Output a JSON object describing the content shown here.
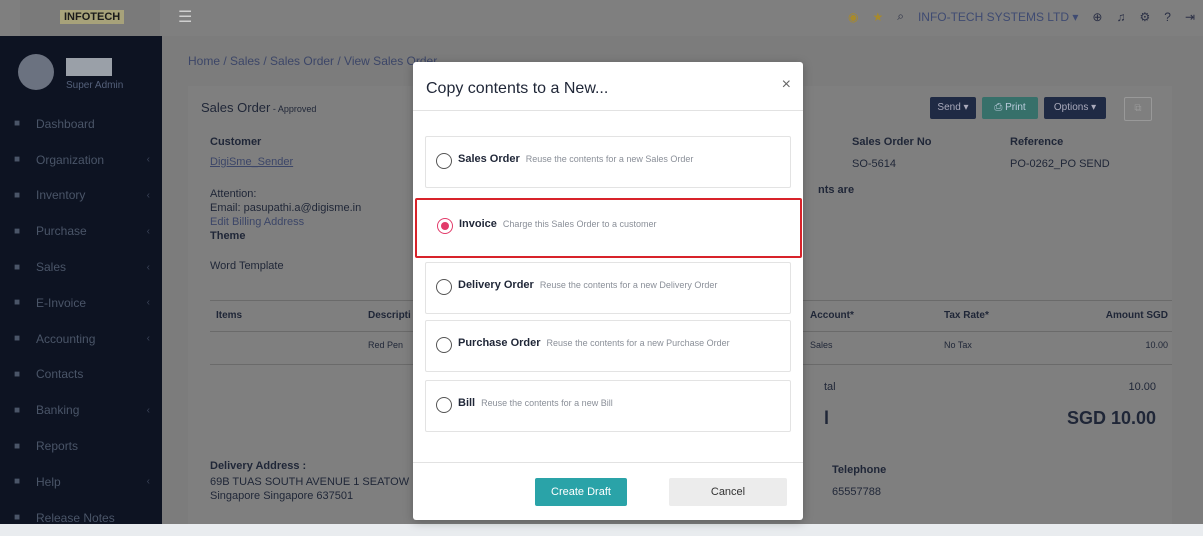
{
  "header": {
    "logo_text": "INFOTECH",
    "company": "INFO-TECH SYSTEMS LTD ▾"
  },
  "user": {
    "role": "Super Admin"
  },
  "sidebar": {
    "items": [
      {
        "label": "Dashboard",
        "icon": "dashboard-icon",
        "chev": false
      },
      {
        "label": "Organization",
        "icon": "organization-icon",
        "chev": true
      },
      {
        "label": "Inventory",
        "icon": "inventory-icon",
        "chev": true
      },
      {
        "label": "Purchase",
        "icon": "purchase-icon",
        "chev": true
      },
      {
        "label": "Sales",
        "icon": "sales-icon",
        "chev": true
      },
      {
        "label": "E-Invoice",
        "icon": "einvoice-icon",
        "chev": true
      },
      {
        "label": "Accounting",
        "icon": "accounting-icon",
        "chev": true
      },
      {
        "label": "Contacts",
        "icon": "contacts-icon",
        "chev": false
      },
      {
        "label": "Banking",
        "icon": "banking-icon",
        "chev": true
      },
      {
        "label": "Reports",
        "icon": "reports-icon",
        "chev": false
      },
      {
        "label": "Help",
        "icon": "help-icon",
        "chev": true
      },
      {
        "label": "Release Notes",
        "icon": "release-notes-icon",
        "chev": false
      }
    ]
  },
  "breadcrumb": "Home / Sales / Sales Order / View Sales Order",
  "order": {
    "title": "Sales Order",
    "status": " - Approved",
    "send_label": "Send ▾",
    "print_label": "⎙ Print",
    "options_label": "Options ▾",
    "customer_label": "Customer",
    "customer_name": "DigiSme_Sender",
    "attention_label": "Attention:",
    "email": "Email: pasupathi.a@digisme.in",
    "edit_billing": "Edit Billing Address",
    "theme_label": "Theme",
    "theme_value": "Word Template",
    "so_no_label": "Sales Order No",
    "so_no": "SO-5614",
    "reference_label": "Reference",
    "reference": "PO-0262_PO SEND",
    "amounts_are": "nts are",
    "table": {
      "headers": {
        "items": "Items",
        "desc": "Descripti",
        "account": "Account*",
        "tax": "Tax Rate*",
        "amount": "Amount SGD"
      },
      "row": {
        "desc": "Red Pen",
        "account": "Sales",
        "tax": "No Tax",
        "amount": "10.00"
      }
    },
    "subtotal_label": "tal",
    "subtotal": "10.00",
    "total_label": "l",
    "total": "SGD 10.00",
    "delivery_label": "Delivery Address :",
    "delivery_line1": "69B TUAS SOUTH AVENUE 1 SEATOW",
    "delivery_line2": "Singapore Singapore 637501",
    "telephone_label": "Telephone",
    "telephone": "65557788"
  },
  "modal": {
    "title": "Copy contents to a New...",
    "close": "×",
    "options": [
      {
        "name": "Sales Order",
        "desc": "Reuse the contents for a new Sales Order",
        "selected": false
      },
      {
        "name": "Invoice",
        "desc": "Charge this Sales Order to a customer",
        "selected": true
      },
      {
        "name": "Delivery Order",
        "desc": "Reuse the contents for a new Delivery Order",
        "selected": false
      },
      {
        "name": "Purchase Order",
        "desc": "Reuse the contents for a new Purchase Order",
        "selected": false
      },
      {
        "name": "Bill",
        "desc": "Reuse the contents for a new Bill",
        "selected": false
      }
    ],
    "create_label": "Create Draft",
    "cancel_label": "Cancel"
  },
  "colors": {
    "accent": "#2aa3a8",
    "highlight": "#d8232a",
    "radio": "#e23b6a"
  }
}
